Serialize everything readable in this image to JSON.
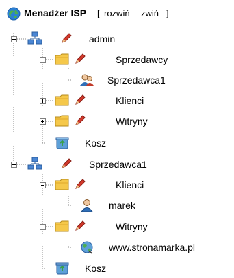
{
  "header": {
    "title": "Menadżer ISP",
    "bracket_open": "[",
    "expand_label": "rozwiń",
    "collapse_label": "zwiń",
    "bracket_close": "]"
  },
  "tree": {
    "admin": "admin",
    "sellers": "Sprzedawcy",
    "seller1": "Sprzedawca1",
    "clients": "Klienci",
    "sites": "Witryny",
    "trash": "Kosz",
    "seller_root": "Sprzedawca1",
    "clients2": "Klienci",
    "user_marek": "marek",
    "sites2": "Witryny",
    "site_url": "www.stronamarka.pl",
    "trash2": "Kosz"
  },
  "colors": {
    "globe": "#2a7fd4",
    "folder": "#f5c84a",
    "pencil": "#d33a2c",
    "network": "#3b78c9",
    "line": "#888888"
  }
}
